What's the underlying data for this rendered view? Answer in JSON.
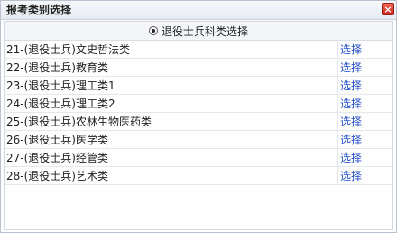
{
  "dialog": {
    "title": "报考类别选择",
    "close_label": "×"
  },
  "group": {
    "label": "退役士兵科类选择",
    "selected": true
  },
  "rows": [
    {
      "name": "21-(退役士兵)文史哲法类",
      "action": "选择"
    },
    {
      "name": "22-(退役士兵)教育类",
      "action": "选择"
    },
    {
      "name": "23-(退役士兵)理工类1",
      "action": "选择"
    },
    {
      "name": "24-(退役士兵)理工类2",
      "action": "选择"
    },
    {
      "name": "25-(退役士兵)农林生物医药类",
      "action": "选择"
    },
    {
      "name": "26-(退役士兵)医学类",
      "action": "选择"
    },
    {
      "name": "27-(退役士兵)经管类",
      "action": "选择"
    },
    {
      "name": "28-(退役士兵)艺术类",
      "action": "选择"
    }
  ]
}
